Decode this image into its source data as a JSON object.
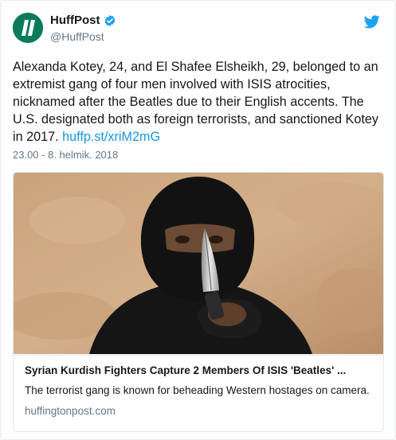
{
  "author": {
    "display_name": "HuffPost",
    "handle": "@HuffPost",
    "verified": true
  },
  "tweet": {
    "text": "Alexanda Kotey, 24, and El Shafee Elsheikh, 29, belonged to an extremist gang of four men involved with ISIS atrocities, nicknamed after the Beatles due to their English accents. The U.S. designated both as foreign terrorists, and sanctioned Kotey in 2017.",
    "link_text": "huffp.st/xriM2mG",
    "timestamp": "23.00 - 8. helmik. 2018"
  },
  "card": {
    "title": "Syrian Kurdish Fighters Capture 2 Members Of ISIS 'Beatles' ...",
    "description": "The terrorist gang is known for beheading Western hostages on camera.",
    "domain": "huffingtonpost.com"
  },
  "icons": {
    "brand": "twitter-bird-icon",
    "verified": "verified-badge-icon"
  },
  "colors": {
    "link": "#1b95e0",
    "verified": "#1da1f2",
    "avatar": "#0e7a5c",
    "muted": "#657786"
  }
}
